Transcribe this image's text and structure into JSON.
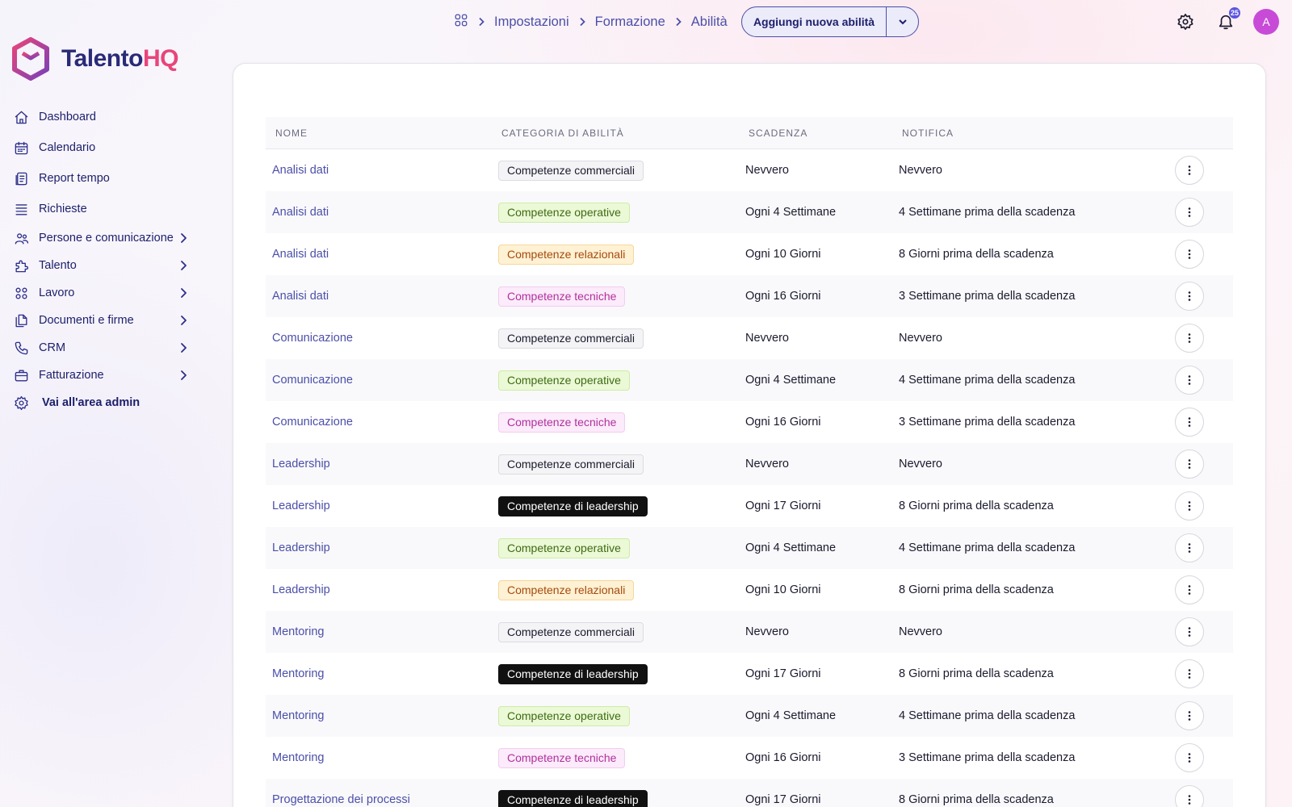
{
  "app": {
    "logo_part1": "Talento",
    "logo_part2": "HQ"
  },
  "sidebar": {
    "items": [
      {
        "label": "Dashboard",
        "icon": "home-icon"
      },
      {
        "label": "Calendario",
        "icon": "calendar-icon"
      },
      {
        "label": "Report tempo",
        "icon": "report-icon"
      },
      {
        "label": "Richieste",
        "icon": "list-icon"
      },
      {
        "label": "Persone e comunicazione",
        "icon": "people-icon"
      },
      {
        "label": "Talento",
        "icon": "puzzle-icon"
      },
      {
        "label": "Lavoro",
        "icon": "apps-icon"
      },
      {
        "label": "Documenti e firme",
        "icon": "documents-icon"
      },
      {
        "label": "CRM",
        "icon": "phone-icon"
      },
      {
        "label": "Fatturazione",
        "icon": "briefcase-icon"
      },
      {
        "label": "Vai all'area admin",
        "icon": "gear-icon"
      }
    ]
  },
  "breadcrumb": {
    "items": [
      "Impostazioni",
      "Formazione",
      "Abilità"
    ]
  },
  "toolbar": {
    "add_label": "Aggiungi nuova abilità",
    "notifications_count": "25",
    "avatar_initial": "A"
  },
  "table": {
    "headers": {
      "name": "NOME",
      "category": "CATEGORIA DI ABILITÀ",
      "due": "SCADENZA",
      "notification": "NOTIFICA"
    },
    "rows": [
      {
        "name": "Analisi dati",
        "category": "Competenze commerciali",
        "due": "Nevvero",
        "notification": "Nevvero"
      },
      {
        "name": "Analisi dati",
        "category": "Competenze operative",
        "due": "Ogni 4 Settimane",
        "notification": "4 Settimane prima della scadenza"
      },
      {
        "name": "Analisi dati",
        "category": "Competenze relazionali",
        "due": "Ogni 10 Giorni",
        "notification": "8 Giorni prima della scadenza"
      },
      {
        "name": "Analisi dati",
        "category": "Competenze tecniche",
        "due": "Ogni 16 Giorni",
        "notification": "3 Settimane prima della scadenza"
      },
      {
        "name": "Comunicazione",
        "category": "Competenze commerciali",
        "due": "Nevvero",
        "notification": "Nevvero"
      },
      {
        "name": "Comunicazione",
        "category": "Competenze operative",
        "due": "Ogni 4 Settimane",
        "notification": "4 Settimane prima della scadenza"
      },
      {
        "name": "Comunicazione",
        "category": "Competenze tecniche",
        "due": "Ogni 16 Giorni",
        "notification": "3 Settimane prima della scadenza"
      },
      {
        "name": "Leadership",
        "category": "Competenze commerciali",
        "due": "Nevvero",
        "notification": "Nevvero"
      },
      {
        "name": "Leadership",
        "category": "Competenze di leadership",
        "due": "Ogni 17 Giorni",
        "notification": "8 Giorni prima della scadenza"
      },
      {
        "name": "Leadership",
        "category": "Competenze operative",
        "due": "Ogni 4 Settimane",
        "notification": "4 Settimane prima della scadenza"
      },
      {
        "name": "Leadership",
        "category": "Competenze relazionali",
        "due": "Ogni 10 Giorni",
        "notification": "8 Giorni prima della scadenza"
      },
      {
        "name": "Mentoring",
        "category": "Competenze commerciali",
        "due": "Nevvero",
        "notification": "Nevvero"
      },
      {
        "name": "Mentoring",
        "category": "Competenze di leadership",
        "due": "Ogni 17 Giorni",
        "notification": "8 Giorni prima della scadenza"
      },
      {
        "name": "Mentoring",
        "category": "Competenze operative",
        "due": "Ogni 4 Settimane",
        "notification": "4 Settimane prima della scadenza"
      },
      {
        "name": "Mentoring",
        "category": "Competenze tecniche",
        "due": "Ogni 16 Giorni",
        "notification": "3 Settimane prima della scadenza"
      },
      {
        "name": "Progettazione dei processi",
        "category": "Competenze di leadership",
        "due": "Ogni 17 Giorni",
        "notification": "8 Giorni prima della scadenza"
      }
    ]
  },
  "colors": {
    "accent": "#4b4fa8",
    "brand_pink": "#e8457a",
    "brand_navy": "#2a2a78"
  }
}
